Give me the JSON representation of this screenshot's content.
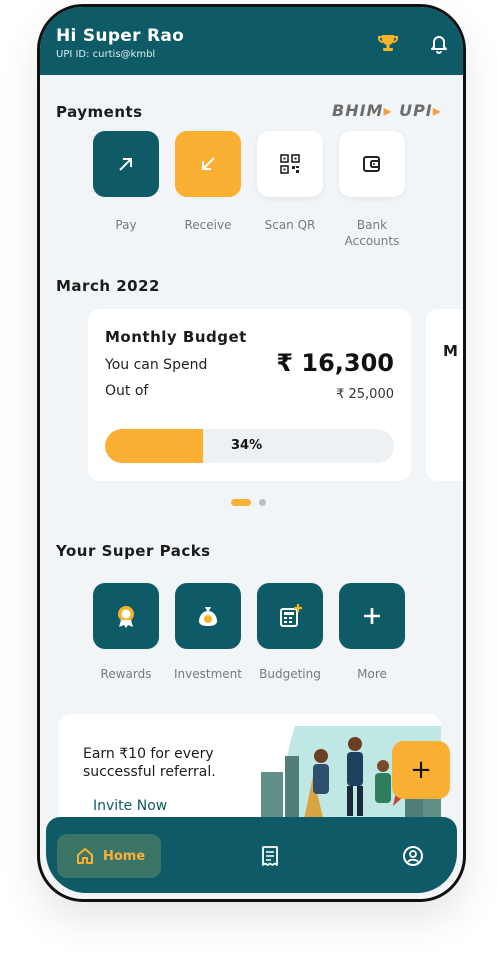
{
  "header": {
    "greeting": "Hi Super Rao",
    "upi_id": "UPI ID: curtis@kmbl",
    "icons": [
      "trophy-icon",
      "bell-icon"
    ]
  },
  "payments": {
    "title": "Payments",
    "brand": "BHIM UPI",
    "items": [
      {
        "label": "Pay",
        "icon": "arrow-up-right-icon"
      },
      {
        "label": "Receive",
        "icon": "arrow-down-left-icon"
      },
      {
        "label": "Scan QR",
        "icon": "qr-code-icon"
      },
      {
        "label": "Bank Accounts",
        "icon": "wallet-icon"
      }
    ]
  },
  "budget": {
    "month": "March 2022",
    "card_title": "Monthly Budget",
    "spend_label": "You can Spend",
    "spend_amount": "₹ 16,300",
    "out_of_label": "Out of",
    "total_amount": "₹ 25,000",
    "progress_label": "34%",
    "progress_fraction": 0.34,
    "next_card_peek": "M",
    "pager": {
      "count": 2,
      "active": 0
    }
  },
  "packs": {
    "title": "Your Super Packs",
    "items": [
      {
        "label": "Rewards",
        "icon": "rewards-badge-icon"
      },
      {
        "label": "Investment",
        "icon": "money-bag-icon"
      },
      {
        "label": "Budgeting",
        "icon": "calculator-icon"
      },
      {
        "label": "More",
        "icon": "plus-icon"
      }
    ]
  },
  "referral": {
    "text": "Earn ₹10 for every successful referral.",
    "cta": "Invite Now"
  },
  "fab": {
    "icon": "plus-icon",
    "label": "+"
  },
  "bottom_nav": {
    "home_label": "Home",
    "icons": [
      "home-icon",
      "receipt-icon",
      "profile-icon"
    ]
  },
  "colors": {
    "primary": "#0e5b67",
    "accent": "#fbb033",
    "background": "#f1f5f8"
  }
}
